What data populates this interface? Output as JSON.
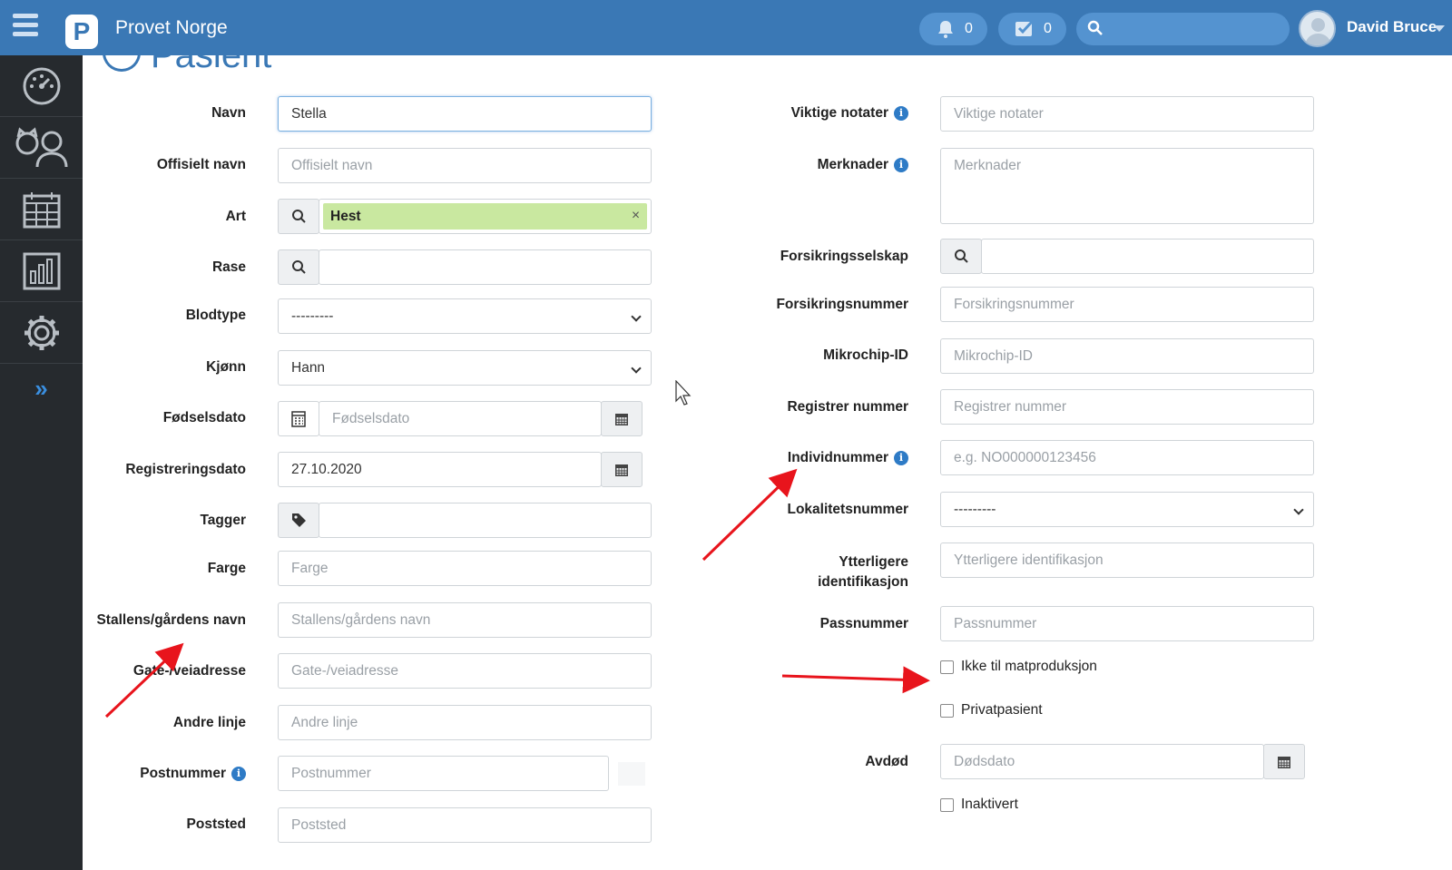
{
  "topbar": {
    "brand": "Provet Norge",
    "notifications_count": "0",
    "tasks_count": "0",
    "search_placeholder": "",
    "username": "David Bruce"
  },
  "sidebar": {
    "items": [
      {
        "icon": "dashboard-icon"
      },
      {
        "icon": "patients-icon"
      },
      {
        "icon": "calendar-icon"
      },
      {
        "icon": "reports-icon"
      },
      {
        "icon": "settings-icon"
      }
    ],
    "expand_label": "»"
  },
  "page": {
    "title": "Pasient"
  },
  "left_form": {
    "navn": {
      "label": "Navn",
      "value": "Stella"
    },
    "offisielt_navn": {
      "label": "Offisielt navn",
      "placeholder": "Offisielt navn"
    },
    "art": {
      "label": "Art",
      "value": "Hest"
    },
    "rase": {
      "label": "Rase",
      "value": ""
    },
    "blodtype": {
      "label": "Blodtype",
      "value": "---------"
    },
    "kjonn": {
      "label": "Kjønn",
      "value": "Hann"
    },
    "fodselsdato": {
      "label": "Fødselsdato",
      "placeholder": "Fødselsdato"
    },
    "registreringsdato": {
      "label": "Registreringsdato",
      "value": "27.10.2020"
    },
    "tagger": {
      "label": "Tagger",
      "value": ""
    },
    "farge": {
      "label": "Farge",
      "placeholder": "Farge"
    },
    "stallens": {
      "label": "Stallens/gårdens navn",
      "placeholder": "Stallens/gårdens navn"
    },
    "gate": {
      "label": "Gate-/veiadresse",
      "placeholder": "Gate-/veiadresse"
    },
    "andre_linje": {
      "label": "Andre linje",
      "placeholder": "Andre linje"
    },
    "postnummer": {
      "label": "Postnummer",
      "placeholder": "Postnummer"
    },
    "poststed": {
      "label": "Poststed",
      "placeholder": "Poststed"
    }
  },
  "right_form": {
    "viktige_notater": {
      "label": "Viktige notater",
      "placeholder": "Viktige notater"
    },
    "merknader": {
      "label": "Merknader",
      "placeholder": "Merknader"
    },
    "forsikringsselskap": {
      "label": "Forsikringsselskap",
      "value": ""
    },
    "forsikringsnummer": {
      "label": "Forsikringsnummer",
      "placeholder": "Forsikringsnummer"
    },
    "mikrochip": {
      "label": "Mikrochip-ID",
      "placeholder": "Mikrochip-ID"
    },
    "registrer_nummer": {
      "label": "Registrer nummer",
      "placeholder": "Registrer nummer"
    },
    "individnummer": {
      "label": "Individnummer",
      "placeholder": "e.g. NO000000123456"
    },
    "lokalitetsnummer": {
      "label": "Lokalitetsnummer",
      "value": "---------"
    },
    "ytterligere_line1": "Ytterligere",
    "ytterligere_line2": "identifikasjon",
    "ytterligere_placeholder": "Ytterligere identifikasjon",
    "passnummer": {
      "label": "Passnummer",
      "placeholder": "Passnummer"
    },
    "ikke_matproduksjon": "Ikke til matproduksjon",
    "privatpasient": "Privatpasient",
    "avdod": {
      "label": "Avdød",
      "placeholder": "Dødsdato"
    },
    "inaktivert": "Inaktivert"
  },
  "colors": {
    "topbar": "#3a78b5",
    "sidebar": "#262a2e",
    "art_tag_bg": "#c9e8a0",
    "annotation_arrow": "#e8141c"
  }
}
